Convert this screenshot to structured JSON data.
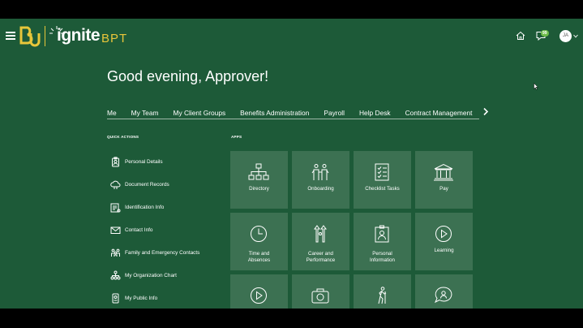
{
  "header": {
    "logo_ignite": "ignite",
    "logo_bpt": "BPT",
    "notification_count": "99",
    "avatar_initials": "JA",
    "brand_green": "#1d5a38",
    "brand_gold": "#e8c63a"
  },
  "greeting": "Good evening, Approver!",
  "tabs": [
    {
      "label": "Me",
      "active": true
    },
    {
      "label": "My Team"
    },
    {
      "label": "My Client Groups"
    },
    {
      "label": "Benefits Administration"
    },
    {
      "label": "Payroll"
    },
    {
      "label": "Help Desk"
    },
    {
      "label": "Contract Management"
    }
  ],
  "quick_actions": {
    "title": "QUICK ACTIONS",
    "items": [
      {
        "label": "Personal Details",
        "icon": "person-badge-icon"
      },
      {
        "label": "Document Records",
        "icon": "document-cloud-icon"
      },
      {
        "label": "Identification Info",
        "icon": "id-card-icon"
      },
      {
        "label": "Contact Info",
        "icon": "envelope-icon"
      },
      {
        "label": "Family and Emergency Contacts",
        "icon": "family-icon"
      },
      {
        "label": "My Organization Chart",
        "icon": "org-chart-icon"
      },
      {
        "label": "My Public Info",
        "icon": "public-info-icon"
      }
    ]
  },
  "apps": {
    "title": "APPS",
    "tiles": [
      {
        "label": "Directory",
        "icon": "directory-icon"
      },
      {
        "label": "Onboarding",
        "icon": "onboarding-icon"
      },
      {
        "label": "Checklist Tasks",
        "icon": "checklist-icon"
      },
      {
        "label": "Pay",
        "icon": "bank-icon"
      },
      {
        "label": "Time and\nAbsences",
        "icon": "clock-icon"
      },
      {
        "label": "Career and\nPerformance",
        "icon": "career-icon"
      },
      {
        "label": "Personal\nInformation",
        "icon": "personal-info-icon"
      },
      {
        "label": "Learning",
        "icon": "play-circle-icon"
      },
      {
        "label": "",
        "icon": "play-circle-icon"
      },
      {
        "label": "",
        "icon": "camera-icon"
      },
      {
        "label": "",
        "icon": "hiker-icon"
      },
      {
        "label": "",
        "icon": "chat-person-icon"
      }
    ]
  }
}
